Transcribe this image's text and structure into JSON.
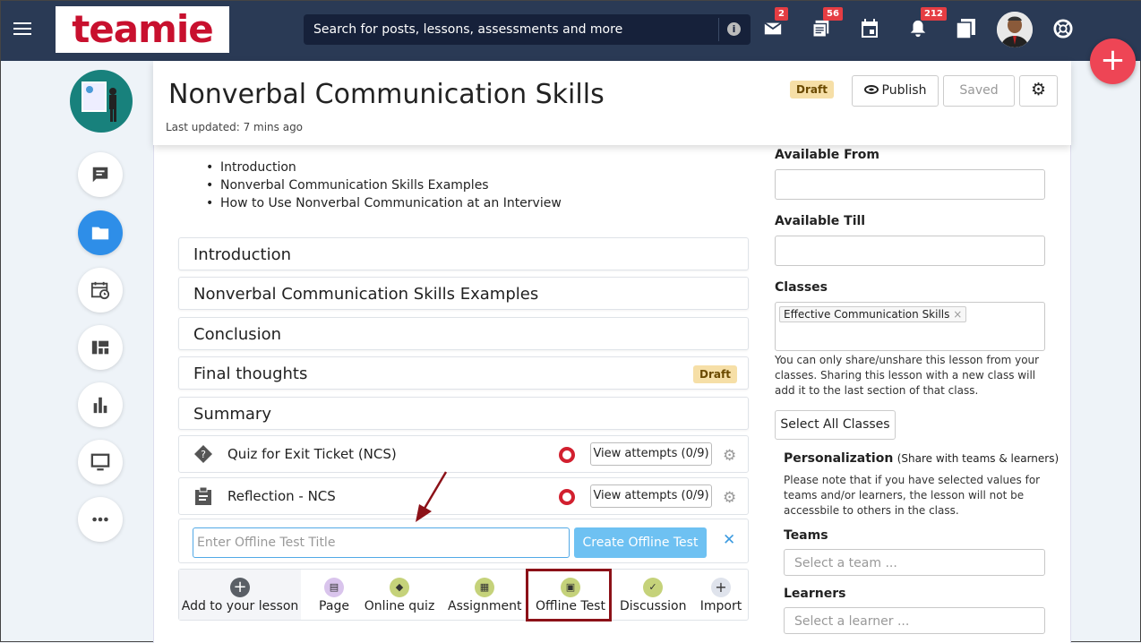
{
  "brand": {
    "logo_text": "teamie",
    "accent": "#ee4555",
    "topbar_color": "#2a3a55"
  },
  "search": {
    "placeholder": "Search for posts, lessons, assessments and more"
  },
  "notifications": {
    "messages_count": "2",
    "posts_count": "56",
    "alerts_count": "212"
  },
  "header": {
    "title": "Nonverbal Communication Skills",
    "last_updated": "Last updated: 7 mins ago",
    "status": "Draft",
    "publish_label": "Publish",
    "saved_label": "Saved"
  },
  "toc": [
    "Introduction",
    "Nonverbal Communication Skills Examples",
    "How to Use Nonverbal Communication at an Interview"
  ],
  "sections": [
    {
      "title": "Introduction"
    },
    {
      "title": "Nonverbal Communication Skills Examples"
    },
    {
      "title": "Conclusion"
    },
    {
      "title": "Final thoughts",
      "badge": "Draft"
    },
    {
      "title": "Summary"
    }
  ],
  "items": [
    {
      "title": "Quiz for Exit Ticket (NCS)",
      "icon": "quiz-icon",
      "attempts": "View attempts (0/9)"
    },
    {
      "title": "Reflection - NCS",
      "icon": "clipboard-icon",
      "attempts": "View attempts (0/9)"
    }
  ],
  "offline": {
    "placeholder": "Enter Offline Test Title",
    "create_label": "Create Offline Test"
  },
  "add_bar": {
    "label": "Add to your lesson",
    "options": [
      {
        "label": "Page",
        "color": "#d9c4ec",
        "icon": "page-icon"
      },
      {
        "label": "Online quiz",
        "color": "#c5d27a",
        "icon": "quiz-icon"
      },
      {
        "label": "Assignment",
        "color": "#c5d27a",
        "icon": "assignment-icon"
      },
      {
        "label": "Offline Test",
        "color": "#c5d27a",
        "icon": "offline-test-icon"
      },
      {
        "label": "Discussion",
        "color": "#c5d27a",
        "icon": "discussion-icon"
      },
      {
        "label": "Import",
        "color": "#dfe3ec",
        "icon": "plus-icon"
      }
    ]
  },
  "right": {
    "available_from": "Available From",
    "available_till": "Available Till",
    "classes_label": "Classes",
    "class_tag": "Effective Communication Skills",
    "share_note": [
      "You can only share/unshare this lesson from your",
      "classes. Sharing this lesson with a new class will",
      "add it to the last section of that class."
    ],
    "select_all": "Select All Classes",
    "personalization": "Personalization",
    "personalization_sub": "(Share with teams & learners)",
    "personal_note": [
      "Please note that if you have selected values for",
      "teams and/or learners, the lesson will not be",
      "accessbile to others in the class."
    ],
    "teams_label": "Teams",
    "teams_placeholder": "Select a team ...",
    "learners_label": "Learners",
    "learners_placeholder": "Select a learner ..."
  }
}
